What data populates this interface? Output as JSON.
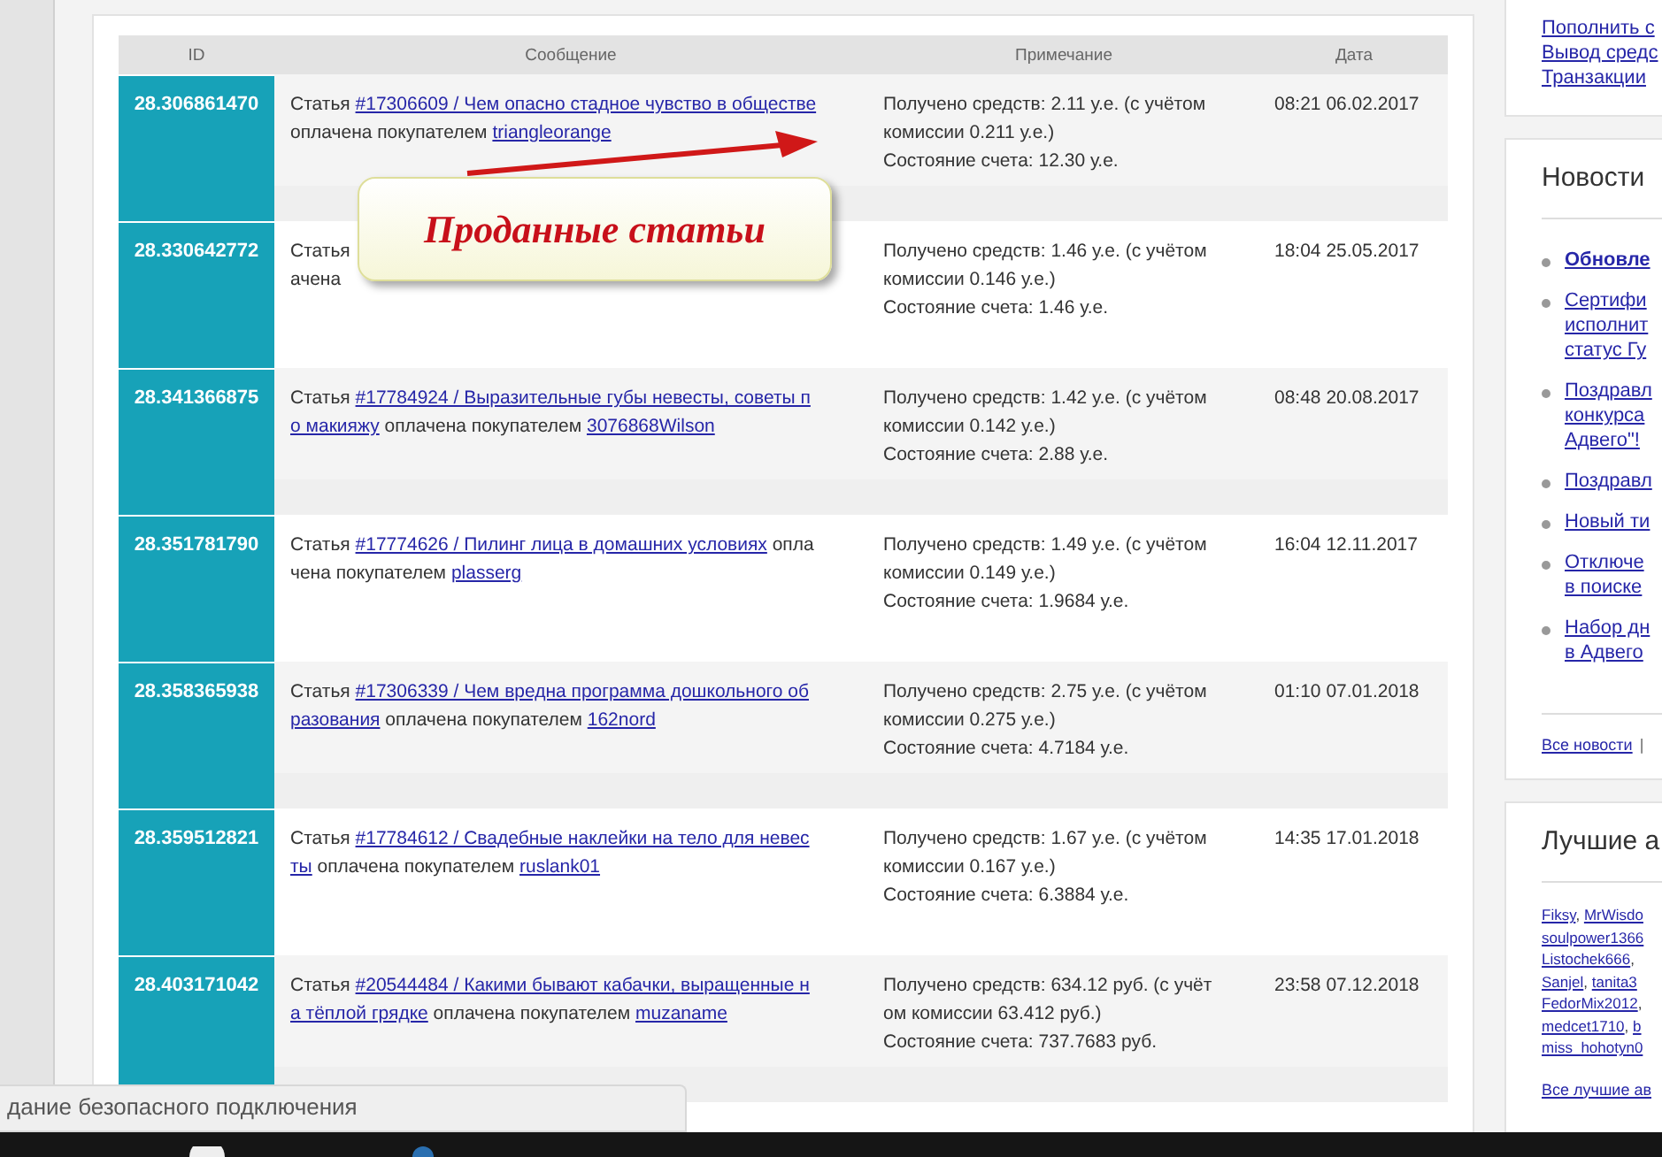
{
  "table": {
    "columns": [
      "ID",
      "Сообщение",
      "Примечание",
      "Дата"
    ],
    "rows": [
      {
        "id": "28.306861470",
        "message": [
          [
            {
              "kind": "text",
              "text": "Статья"
            },
            {
              "kind": "link",
              "text": "#17306609 / Чем опасно стадное чувство в обществе"
            }
          ],
          [
            {
              "kind": "text",
              "text": "оплачена покупателем"
            },
            {
              "kind": "link",
              "text": "triangleorange"
            }
          ]
        ],
        "note": [
          "Получено средств: 2.11 у.е. (с учётом",
          "комиссии 0.211 у.е.)",
          "Состояние счета: 12.30 у.е."
        ],
        "date": "08:21 06.02.2017"
      },
      {
        "id": "28.330642772",
        "message": [
          [
            {
              "kind": "text",
              "text": "Статья"
            }
          ],
          [
            {
              "kind": "text",
              "text": "ачена"
            }
          ]
        ],
        "note": [
          "Получено средств: 1.46 у.е. (с учётом",
          "комиссии 0.146 у.е.)",
          "Состояние счета: 1.46 у.е."
        ],
        "date": "18:04 25.05.2017"
      },
      {
        "id": "28.341366875",
        "message": [
          [
            {
              "kind": "text",
              "text": "Статья"
            },
            {
              "kind": "link",
              "text": "#17784924 / Выразительные губы невесты, советы п"
            }
          ],
          [
            {
              "kind": "link",
              "text": "о макияжу"
            },
            {
              "kind": "text",
              "text": "оплачена покупателем"
            },
            {
              "kind": "link",
              "text": "3076868Wilson"
            }
          ]
        ],
        "note": [
          "Получено средств: 1.42 у.е. (с учётом",
          "комиссии 0.142 у.е.)",
          "Состояние счета: 2.88 у.е."
        ],
        "date": "08:48 20.08.2017"
      },
      {
        "id": "28.351781790",
        "message": [
          [
            {
              "kind": "text",
              "text": "Статья"
            },
            {
              "kind": "link",
              "text": "#17774626 / Пилинг лица в домашних условиях"
            },
            {
              "kind": "text",
              "text": "опла"
            }
          ],
          [
            {
              "kind": "text",
              "text": "чена покупателем"
            },
            {
              "kind": "link",
              "text": "plasserg"
            }
          ]
        ],
        "note": [
          "Получено средств: 1.49 у.е. (с учётом",
          "комиссии 0.149 у.е.)",
          "Состояние счета: 1.9684 у.е."
        ],
        "date": "16:04 12.11.2017"
      },
      {
        "id": "28.358365938",
        "message": [
          [
            {
              "kind": "text",
              "text": "Статья"
            },
            {
              "kind": "link",
              "text": "#17306339 / Чем вредна программа дошкольного об"
            }
          ],
          [
            {
              "kind": "link",
              "text": "разования"
            },
            {
              "kind": "text",
              "text": "оплачена покупателем"
            },
            {
              "kind": "link",
              "text": "162nord"
            }
          ]
        ],
        "note": [
          "Получено средств: 2.75 у.е. (с учётом",
          "комиссии 0.275 у.е.)",
          "Состояние счета: 4.7184 у.е."
        ],
        "date": "01:10 07.01.2018"
      },
      {
        "id": "28.359512821",
        "message": [
          [
            {
              "kind": "text",
              "text": "Статья"
            },
            {
              "kind": "link",
              "text": "#17784612 / Свадебные наклейки на тело для невес"
            }
          ],
          [
            {
              "kind": "link",
              "text": "ты"
            },
            {
              "kind": "text",
              "text": "оплачена покупателем"
            },
            {
              "kind": "link",
              "text": "ruslank01"
            }
          ]
        ],
        "note": [
          "Получено средств: 1.67 у.е. (с учётом",
          "комиссии 0.167 у.е.)",
          "Состояние счета: 6.3884 у.е."
        ],
        "date": "14:35 17.01.2018"
      },
      {
        "id": "28.403171042",
        "message": [
          [
            {
              "kind": "text",
              "text": "Статья"
            },
            {
              "kind": "link",
              "text": "#20544484 / Какими бывают кабачки, выращенные н"
            }
          ],
          [
            {
              "kind": "link",
              "text": "а тёплой грядке"
            },
            {
              "kind": "text",
              "text": "оплачена покупателем"
            },
            {
              "kind": "link",
              "text": "muzaname"
            }
          ]
        ],
        "note": [
          "Получено средств: 634.12 руб. (с учёт",
          "ом комиссии 63.412 руб.)",
          "Состояние счета: 737.7683 руб."
        ],
        "date": "23:58 07.12.2018"
      }
    ]
  },
  "callout": {
    "text": "Проданные статьи"
  },
  "sidebar": {
    "account_links": [
      "Пополнить с",
      "Вывод средс",
      "Транзакции"
    ],
    "news": {
      "title": "Новости",
      "items": [
        {
          "lines": [
            "Обновле"
          ],
          "bold": true
        },
        {
          "lines": [
            "Сертифи",
            "исполнит",
            "статус Гу"
          ],
          "bold": false
        },
        {
          "lines": [
            "Поздравл",
            "конкурса",
            "Адвего\"!"
          ],
          "bold": false
        },
        {
          "lines": [
            "Поздравл"
          ],
          "bold": false
        },
        {
          "lines": [
            "Новый ти"
          ],
          "bold": false
        },
        {
          "lines": [
            "Отключе",
            "в поиске"
          ],
          "bold": false
        },
        {
          "lines": [
            "Набор дн",
            "в Адвего"
          ],
          "bold": false
        }
      ],
      "all_link": "Все новости",
      "separator": "|"
    },
    "authors": {
      "title": "Лучшие а",
      "lines": [
        [
          {
            "kind": "link",
            "text": "Fiksy"
          },
          {
            "kind": "text",
            "text": ", "
          },
          {
            "kind": "link",
            "text": "MrWisdo"
          }
        ],
        [
          {
            "kind": "link",
            "text": "soulpower1366"
          }
        ],
        [
          {
            "kind": "link",
            "text": "Listochek666"
          },
          {
            "kind": "text",
            "text": ", "
          }
        ],
        [
          {
            "kind": "link",
            "text": "Sanjel"
          },
          {
            "kind": "text",
            "text": ", "
          },
          {
            "kind": "link",
            "text": "tanita3"
          }
        ],
        [
          {
            "kind": "link",
            "text": "FedorMix2012"
          },
          {
            "kind": "text",
            "text": ", "
          }
        ],
        [
          {
            "kind": "link",
            "text": "medcet1710"
          },
          {
            "kind": "text",
            "text": ", "
          },
          {
            "kind": "link",
            "text": "b"
          }
        ],
        [
          {
            "kind": "link",
            "text": "miss_hohotyn0"
          }
        ]
      ],
      "all_link": "Все лучшие ав"
    }
  },
  "status_popup": {
    "text": "дание безопасного подключения"
  }
}
